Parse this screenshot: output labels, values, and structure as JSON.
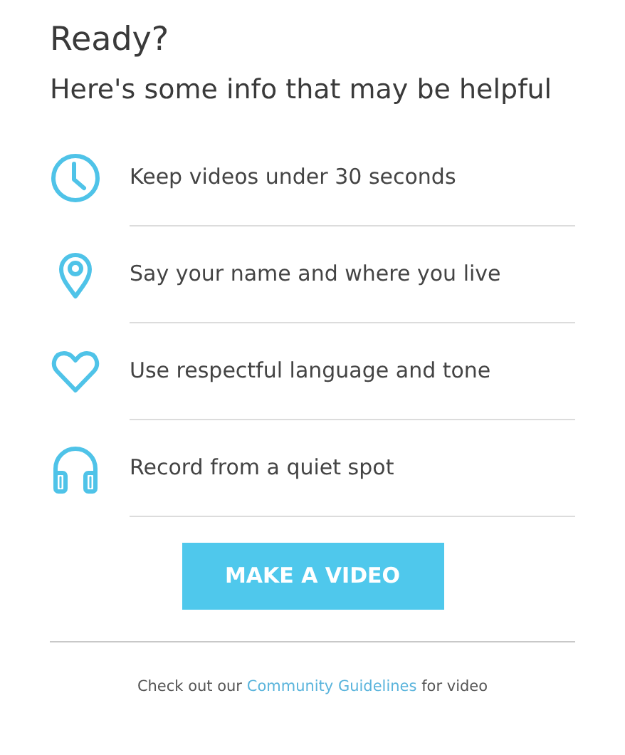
{
  "title": "Ready?",
  "subtitle": "Here's some info that may be helpful",
  "tips": [
    {
      "kind": "clock",
      "text": "Keep videos under 30 seconds"
    },
    {
      "kind": "pin",
      "text": "Say your name and where you live"
    },
    {
      "kind": "heart",
      "text": "Use respectful language and tone"
    },
    {
      "kind": "headphones",
      "text": "Record from a quiet spot"
    }
  ],
  "button": "MAKE A VIDEO",
  "footer": {
    "before": "Check out our",
    "link": "Community Guidelines",
    "after": "for video"
  }
}
